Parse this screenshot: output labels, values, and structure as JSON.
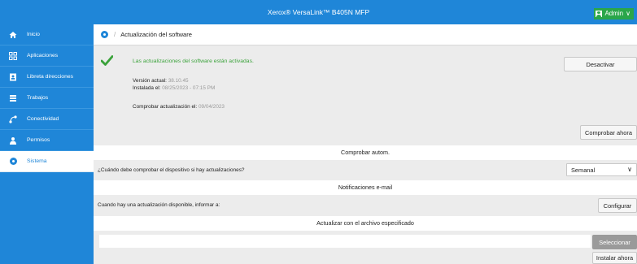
{
  "header": {
    "title": "Xerox® VersaLink™ B405N MFP",
    "user_label": "Admin",
    "user_chevron": "∨"
  },
  "sidebar": {
    "items": [
      {
        "label": "Inicio",
        "icon": "home-icon"
      },
      {
        "label": "Aplicaciones",
        "icon": "apps-icon"
      },
      {
        "label": "Libreta direcciones",
        "icon": "address-book-icon"
      },
      {
        "label": "Trabajos",
        "icon": "jobs-icon"
      },
      {
        "label": "Conectividad",
        "icon": "connectivity-icon"
      },
      {
        "label": "Permisos",
        "icon": "permissions-icon"
      },
      {
        "label": "Sistema",
        "icon": "system-icon",
        "active": true
      }
    ]
  },
  "breadcrumb": {
    "separator": "/",
    "page": "Actualización del software"
  },
  "status": {
    "message": "Las actualizaciones del software están activadas.",
    "version_label": "Versión actual:",
    "version_value": "38.10.45",
    "installed_label": "Instalada el:",
    "installed_value": "08/25/2023 - 07:15 PM",
    "check_label": "Comprobar actualización el:",
    "check_value": "09/04/2023",
    "disable_button": "Desactivar",
    "check_now_button": "Comprobar ahora",
    "check_color": "#3aa23a"
  },
  "auto_check": {
    "heading": "Comprobar autom.",
    "question": "¿Cuándo debe comprobar el dispositivo si hay actualizaciones?",
    "selected": "Semanal"
  },
  "email": {
    "heading": "Notificaciones e-mail",
    "label": "Cuando hay una actualización disponible, informar a:",
    "configure_button": "Configurar"
  },
  "file_update": {
    "heading": "Actualizar con el archivo especificado",
    "select_button": "Seleccionar",
    "install_button": "Instalar ahora"
  },
  "colors": {
    "brand_blue": "#1f86d8",
    "admin_green": "#2aa64a"
  }
}
